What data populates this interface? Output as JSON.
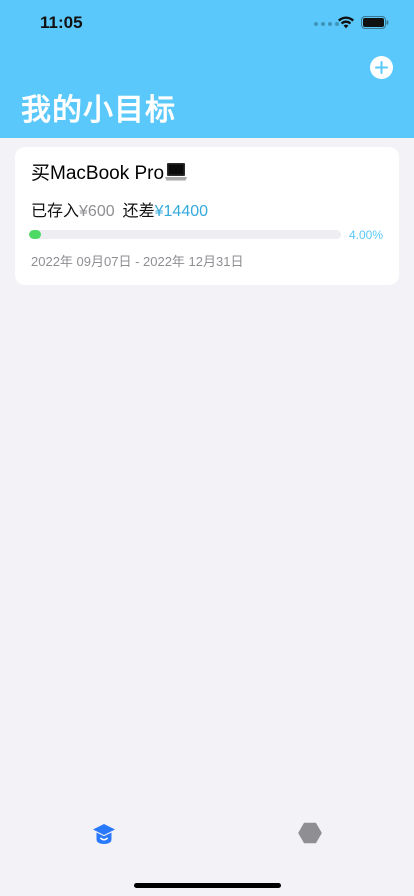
{
  "status_bar": {
    "time": "11:05"
  },
  "header": {
    "title": "我的小目标"
  },
  "goal": {
    "title": "买MacBook Pro",
    "saved_label": "已存入",
    "saved_amount": "¥600",
    "remaining_label": "还差",
    "remaining_amount": "¥14400",
    "progress_text": "4.00%",
    "progress_fraction": 0.04,
    "date_range": "2022年 09月07日 - 2022年 12月31日"
  },
  "colors": {
    "header_bg": "#5ac8fa",
    "progress_fill": "#4cd964",
    "accent": "#34aadc",
    "tab_active": "#2979ff",
    "tab_inactive": "#8e8e93"
  },
  "tabbar": {
    "items": [
      {
        "icon": "graduation-cap-icon",
        "active": true
      },
      {
        "icon": "hexagon-icon",
        "active": false
      }
    ]
  }
}
